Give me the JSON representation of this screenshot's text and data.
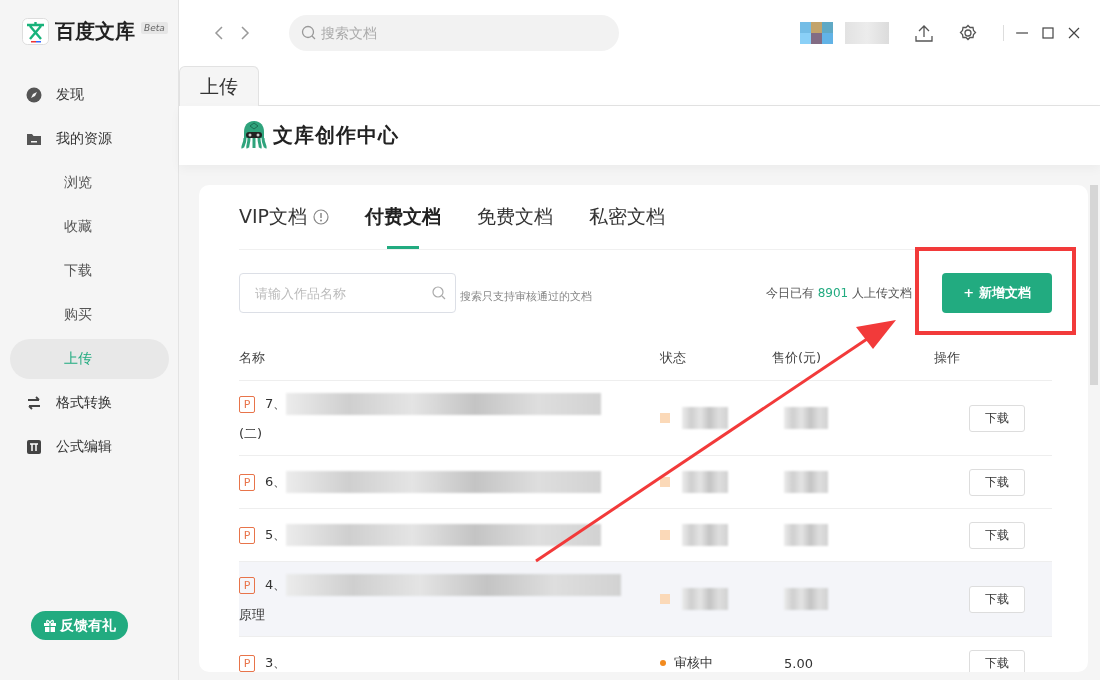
{
  "app": {
    "name": "百度文库",
    "badge": "Beta"
  },
  "sidebar": {
    "items": [
      {
        "label": "发现",
        "selected": false
      },
      {
        "label": "我的资源",
        "selected": false,
        "children": [
          {
            "label": "浏览",
            "selected": false
          },
          {
            "label": "收藏",
            "selected": false
          },
          {
            "label": "下载",
            "selected": false
          },
          {
            "label": "购买",
            "selected": false
          },
          {
            "label": "上传",
            "selected": true
          }
        ]
      },
      {
        "label": "格式转换",
        "selected": false
      },
      {
        "label": "公式编辑",
        "selected": false
      }
    ],
    "feedback_button": "反馈有礼"
  },
  "toolbar": {
    "search_placeholder": "搜索文档"
  },
  "page_tabs": [
    {
      "label": "上传",
      "selected": true
    }
  ],
  "brand": "文库创作中心",
  "doc_tabs": [
    {
      "label": "VIP文档",
      "selected": false,
      "info": true
    },
    {
      "label": "付费文档",
      "selected": true,
      "info": false
    },
    {
      "label": "免费文档",
      "selected": false,
      "info": false
    },
    {
      "label": "私密文档",
      "selected": false,
      "info": false
    }
  ],
  "search": {
    "placeholder": "请输入作品名称",
    "hint": "搜索只支持审核通过的文档"
  },
  "upload_stats": {
    "prefix": "今日已有",
    "count": "8901",
    "suffix": "人上传文档"
  },
  "new_button": "+ 新增文档",
  "table": {
    "columns": [
      "名称",
      "状态",
      "售价(元)",
      "操作"
    ],
    "rows": [
      {
        "file_type": "P",
        "title": "7、",
        "title_line2": "(二)",
        "redacted": true,
        "highlighted": false,
        "action": "下载"
      },
      {
        "file_type": "P",
        "title": "6、",
        "redacted": true,
        "highlighted": false,
        "action": "下载"
      },
      {
        "file_type": "P",
        "title": "5、",
        "redacted": true,
        "highlighted": false,
        "action": "下载"
      },
      {
        "file_type": "P",
        "title": "4、",
        "title_line2": "原理",
        "redacted": true,
        "highlighted": true,
        "action": "下载"
      },
      {
        "file_type": "P",
        "title": "3、",
        "status": "审核中",
        "price": "5.00",
        "redacted": false,
        "highlighted": false,
        "action": "下载"
      }
    ]
  }
}
